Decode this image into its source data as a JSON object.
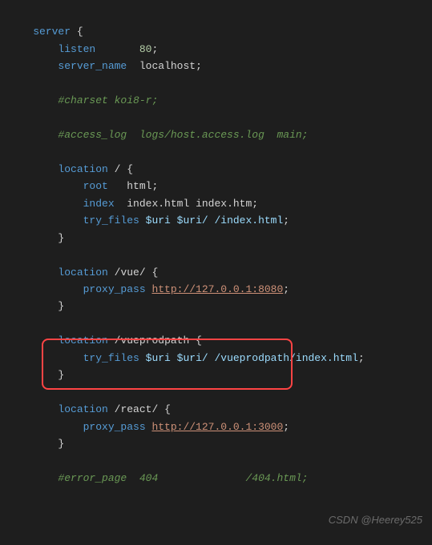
{
  "code": {
    "server_kw": "server",
    "listen_kw": "listen",
    "listen_val": "80",
    "server_name_kw": "server_name",
    "server_name_val": "localhost",
    "comment_charset": "#charset koi8-r;",
    "comment_access": "#access_log  logs/host.access.log  main;",
    "location_kw": "location",
    "loc1_path": "/",
    "root_kw": "root",
    "root_val": "html",
    "index_kw": "index",
    "index_val": "index.html index.htm",
    "tryfiles_kw": "try_files",
    "tryfiles_val1": "$uri $uri/ /index.html",
    "loc2_path": "/vue/",
    "proxy_kw": "proxy_pass",
    "proxy_url1": "http://127.0.0.1:8080",
    "loc3_path": "/vueprodpath",
    "tryfiles_val2": "$uri $uri/ /vueprodpath/index.html",
    "loc4_path": "/react/",
    "proxy_url2": "http://127.0.0.1:3000",
    "comment_error": "#error_page  404              /404.html;",
    "open": "{",
    "close": "}",
    "semi": ";"
  },
  "watermark": "CSDN @Heerey525"
}
